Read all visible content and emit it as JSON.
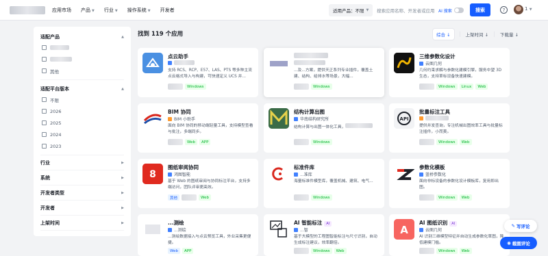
{
  "header": {
    "nav": [
      "应用市场",
      "产品",
      "行业",
      "操作系统",
      "开发者"
    ],
    "product_select": "适用产品：不限",
    "search_placeholder": "搜索应用名称、开发者或应用",
    "ai_search": "AI 搜索",
    "search_button": "搜索",
    "help": "?",
    "user_menu": "1"
  },
  "sidebar": {
    "product_title": "适配产品",
    "product_other": "其他",
    "version_title": "适配平台版本",
    "versions": [
      "不限",
      "2026",
      "2025",
      "2024",
      "2023"
    ],
    "sections": [
      "行业",
      "系统",
      "开发者类型",
      "开发者",
      "上架时间"
    ]
  },
  "main": {
    "result_count": "找到 119 个应用",
    "sort": [
      "综合",
      "上架时间",
      "下载量"
    ]
  },
  "cards": [
    {
      "name": "点云助手",
      "vendor": "",
      "desc": "支持 RCS、RCP、E57、LAS、PTS 等多种主流点云格式导入与构建，可快速定义 UCS 并...",
      "tags": [
        "Windows"
      ]
    },
    {
      "name": "",
      "vendor": "",
      "desc": "...及...方案，提供天正系列专业插件，覆盖土建、结构、给排水等场景，大幅...",
      "tags": [
        "Windows"
      ]
    },
    {
      "name": "三维参数化设计",
      "vendor": "云图几何",
      "desc": "几何约束求解与参数化建模引擎，服务中望 3D 生态，支持草标设备快速建模。",
      "tags": [
        "Windows",
        "Linux",
        "Web"
      ]
    },
    {
      "name": "BIM 协同",
      "vendor": "BIM 小助手",
      "desc": "面向 BIM 协同的移动端轻量工具，支持模型查看与批注，多端同步。",
      "tags": [
        "Web",
        "APP"
      ]
    },
    {
      "name": "结构计算出图",
      "vendor": "华南结构研究所",
      "desc": "结构计算与出图一体化工具，",
      "tags": [
        "Windows"
      ]
    },
    {
      "name": "批量标注工具",
      "vendor": "",
      "desc": "提供并发查询，专注机械出图效率工具与批量标注插件，小而美。",
      "tags": [
        "Windows",
        "Web"
      ]
    },
    {
      "name": "图纸审阅协同",
      "vendor": "鸿图智能",
      "desc": "基于 Web 的图纸审阅与协同标注平台，支持多端访问，团队评审更高效。",
      "tags": [
        "其他",
        "Web"
      ]
    },
    {
      "name": "标准件库",
      "vendor": "...准库",
      "desc": "海量标准件模型库，覆盖机械、建筑、电气...",
      "tags": [
        "Windows"
      ]
    },
    {
      "name": "参数化模板",
      "vendor": "蓝桥参数化",
      "desc": "面向非标设备的参数化设计模板库，复用即出图。",
      "tags": [
        "Windows",
        "Web"
      ]
    },
    {
      "name": "...测绘",
      "vendor": "...测绘",
      "desc": "...测绘数据接入与点云预览工具，外业采集更便捷。",
      "tags": [
        "Web",
        "APP"
      ]
    },
    {
      "name": "AI 智能标注",
      "vendor": "...智",
      "desc": "基于大模型的工程图智能标注与尺寸识别，自动生成标注建议，效率翻倍。",
      "tags": [
        "Windows",
        "Web"
      ]
    },
    {
      "name": "AI 图纸识别",
      "vendor": "云图几何",
      "desc": "AI 识别三维模型特征并自动生成参数化草图，降低建模门槛。",
      "tags": [
        "Windows",
        "Web"
      ]
    }
  ],
  "badges": {
    "ai": "AI"
  },
  "floating": {
    "write_comment": "写评论",
    "screenshot_comment": "截图评论"
  }
}
